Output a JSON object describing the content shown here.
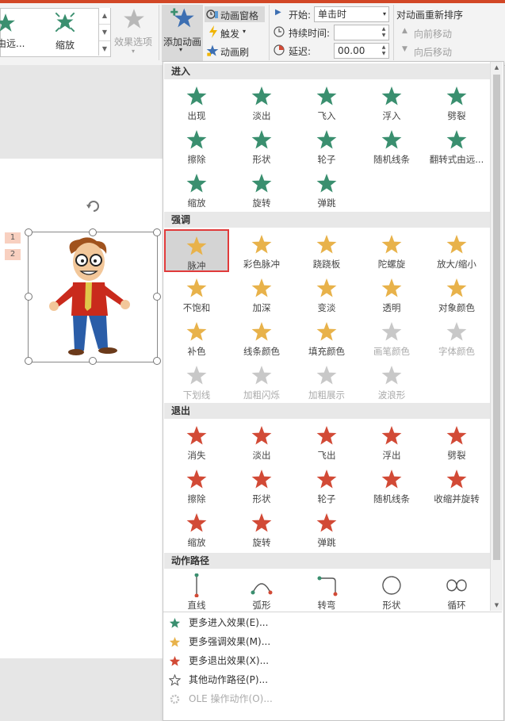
{
  "ribbon": {
    "gallery_items": [
      {
        "label": "由远...",
        "icon": "star-enter-icon"
      },
      {
        "label": "缩放",
        "icon": "star-zoom-icon"
      }
    ],
    "effect_options": "效果选项",
    "add_animation": "添加动画",
    "animation_pane": "动画窗格",
    "trigger": "触发",
    "animation_painter": "动画刷",
    "start_label": "开始:",
    "start_value": "单击时",
    "duration_label": "持续时间:",
    "duration_value": "",
    "delay_label": "延迟:",
    "delay_value": "00.00",
    "reorder_title": "对动画重新排序",
    "move_earlier": "向前移动",
    "move_later": "向后移动"
  },
  "slide": {
    "markers": [
      "1",
      "2"
    ]
  },
  "colors": {
    "enter": "#3a8f6f",
    "emphasis": "#e8b24a",
    "exit": "#d24a36",
    "disabled": "#c8c8c8",
    "selected_border": "#e03a3a"
  },
  "sections": [
    {
      "title": "进入",
      "kind": "enter",
      "items": [
        "出现",
        "淡出",
        "飞入",
        "浮入",
        "劈裂",
        "擦除",
        "形状",
        "轮子",
        "随机线条",
        "翻转式由远...",
        "缩放",
        "旋转",
        "弹跳"
      ]
    },
    {
      "title": "强调",
      "kind": "emphasis",
      "items": [
        "脉冲",
        "彩色脉冲",
        "跷跷板",
        "陀螺旋",
        "放大/缩小",
        "不饱和",
        "加深",
        "变淡",
        "透明",
        "对象颜色",
        "补色",
        "线条颜色",
        "填充颜色",
        "画笔颜色",
        "字体颜色",
        "下划线",
        "加粗闪烁",
        "加粗展示",
        "波浪形"
      ],
      "disabled": [
        "画笔颜色",
        "字体颜色",
        "下划线",
        "加粗闪烁",
        "加粗展示",
        "波浪形"
      ],
      "selected": "脉冲"
    },
    {
      "title": "退出",
      "kind": "exit",
      "items": [
        "消失",
        "淡出",
        "飞出",
        "浮出",
        "劈裂",
        "擦除",
        "形状",
        "轮子",
        "随机线条",
        "收缩并旋转",
        "缩放",
        "旋转",
        "弹跳"
      ]
    },
    {
      "title": "动作路径",
      "kind": "path",
      "items": [
        "直线",
        "弧形",
        "转弯",
        "形状",
        "循环"
      ]
    }
  ],
  "menu": [
    {
      "label": "更多进入效果(E)...",
      "icon": "green-star-icon",
      "enabled": true
    },
    {
      "label": "更多强调效果(M)...",
      "icon": "yellow-star-icon",
      "enabled": true
    },
    {
      "label": "更多退出效果(X)...",
      "icon": "red-star-icon",
      "enabled": true
    },
    {
      "label": "其他动作路径(P)...",
      "icon": "outline-star-icon",
      "enabled": true
    },
    {
      "label": "OLE 操作动作(O)...",
      "icon": "gear-icon",
      "enabled": false
    }
  ]
}
